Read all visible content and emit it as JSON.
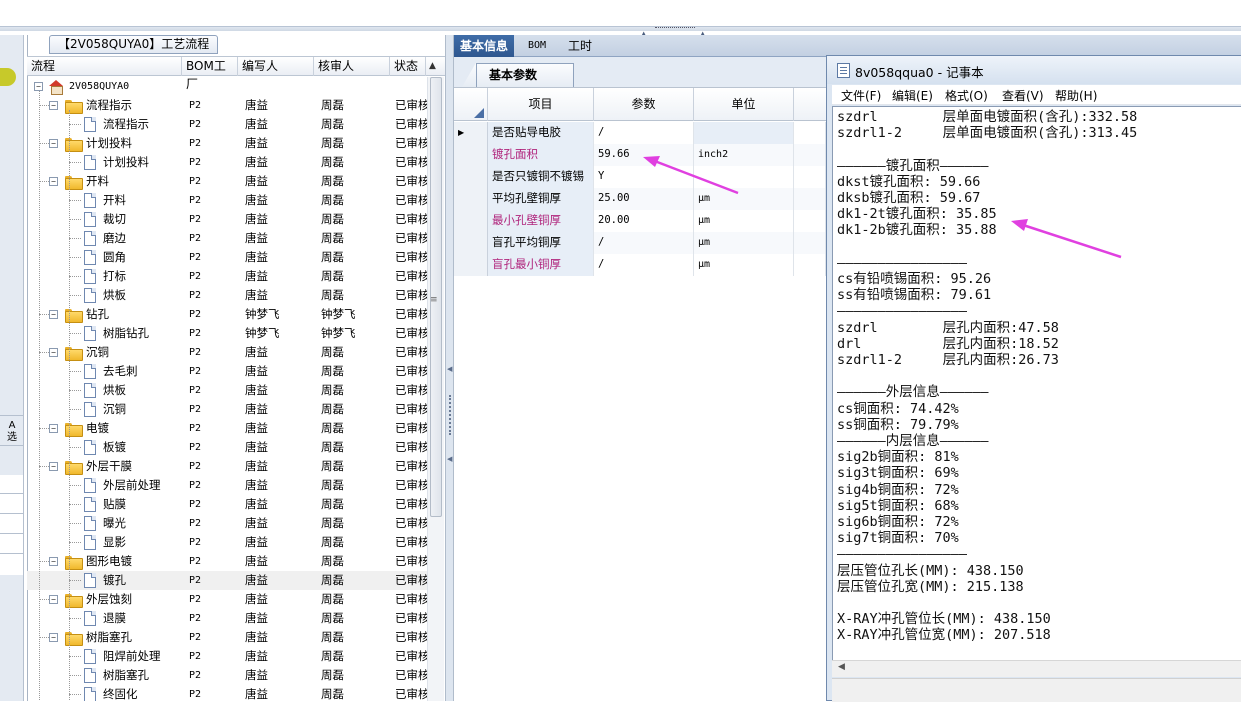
{
  "tree_panel": {
    "title": "【2V058QUYA0】工艺流程",
    "columns": [
      "流程",
      "BOM工厂",
      "编写人",
      "核审人",
      "状态"
    ],
    "rows": [
      {
        "level": 0,
        "type": "root",
        "label": "2V058QUYA0",
        "bom": "",
        "writer": "",
        "reviewer": "",
        "status": ""
      },
      {
        "level": 1,
        "type": "folder",
        "label": "流程指示",
        "bom": "P2",
        "writer": "唐益",
        "reviewer": "周磊",
        "status": "已审核"
      },
      {
        "level": 2,
        "type": "doc",
        "label": "流程指示",
        "bom": "P2",
        "writer": "唐益",
        "reviewer": "周磊",
        "status": "已审核"
      },
      {
        "level": 1,
        "type": "folder",
        "label": "计划投料",
        "bom": "P2",
        "writer": "唐益",
        "reviewer": "周磊",
        "status": "已审核"
      },
      {
        "level": 2,
        "type": "doc",
        "label": "计划投料",
        "bom": "P2",
        "writer": "唐益",
        "reviewer": "周磊",
        "status": "已审核"
      },
      {
        "level": 1,
        "type": "folder",
        "label": "开料",
        "bom": "P2",
        "writer": "唐益",
        "reviewer": "周磊",
        "status": "已审核"
      },
      {
        "level": 2,
        "type": "doc",
        "label": "开料",
        "bom": "P2",
        "writer": "唐益",
        "reviewer": "周磊",
        "status": "已审核"
      },
      {
        "level": 2,
        "type": "doc",
        "label": "裁切",
        "bom": "P2",
        "writer": "唐益",
        "reviewer": "周磊",
        "status": "已审核"
      },
      {
        "level": 2,
        "type": "doc",
        "label": "磨边",
        "bom": "P2",
        "writer": "唐益",
        "reviewer": "周磊",
        "status": "已审核"
      },
      {
        "level": 2,
        "type": "doc",
        "label": "圆角",
        "bom": "P2",
        "writer": "唐益",
        "reviewer": "周磊",
        "status": "已审核"
      },
      {
        "level": 2,
        "type": "doc",
        "label": "打标",
        "bom": "P2",
        "writer": "唐益",
        "reviewer": "周磊",
        "status": "已审核"
      },
      {
        "level": 2,
        "type": "doc",
        "label": "烘板",
        "bom": "P2",
        "writer": "唐益",
        "reviewer": "周磊",
        "status": "已审核"
      },
      {
        "level": 1,
        "type": "folder",
        "label": "钻孔",
        "bom": "P2",
        "writer": "钟梦飞",
        "reviewer": "钟梦飞",
        "status": "已审核"
      },
      {
        "level": 2,
        "type": "doc",
        "label": "树脂钻孔",
        "bom": "P2",
        "writer": "钟梦飞",
        "reviewer": "钟梦飞",
        "status": "已审核"
      },
      {
        "level": 1,
        "type": "folder",
        "label": "沉铜",
        "bom": "P2",
        "writer": "唐益",
        "reviewer": "周磊",
        "status": "已审核"
      },
      {
        "level": 2,
        "type": "doc",
        "label": "去毛刺",
        "bom": "P2",
        "writer": "唐益",
        "reviewer": "周磊",
        "status": "已审核"
      },
      {
        "level": 2,
        "type": "doc",
        "label": "烘板",
        "bom": "P2",
        "writer": "唐益",
        "reviewer": "周磊",
        "status": "已审核"
      },
      {
        "level": 2,
        "type": "doc",
        "label": "沉铜",
        "bom": "P2",
        "writer": "唐益",
        "reviewer": "周磊",
        "status": "已审核"
      },
      {
        "level": 1,
        "type": "folder",
        "label": "电镀",
        "bom": "P2",
        "writer": "唐益",
        "reviewer": "周磊",
        "status": "已审核"
      },
      {
        "level": 2,
        "type": "doc",
        "label": "板镀",
        "bom": "P2",
        "writer": "唐益",
        "reviewer": "周磊",
        "status": "已审核"
      },
      {
        "level": 1,
        "type": "folder",
        "label": "外层干膜",
        "bom": "P2",
        "writer": "唐益",
        "reviewer": "周磊",
        "status": "已审核"
      },
      {
        "level": 2,
        "type": "doc",
        "label": "外层前处理",
        "bom": "P2",
        "writer": "唐益",
        "reviewer": "周磊",
        "status": "已审核"
      },
      {
        "level": 2,
        "type": "doc",
        "label": "贴膜",
        "bom": "P2",
        "writer": "唐益",
        "reviewer": "周磊",
        "status": "已审核"
      },
      {
        "level": 2,
        "type": "doc",
        "label": "曝光",
        "bom": "P2",
        "writer": "唐益",
        "reviewer": "周磊",
        "status": "已审核"
      },
      {
        "level": 2,
        "type": "doc",
        "label": "显影",
        "bom": "P2",
        "writer": "唐益",
        "reviewer": "周磊",
        "status": "已审核"
      },
      {
        "level": 1,
        "type": "folder",
        "label": "图形电镀",
        "bom": "P2",
        "writer": "唐益",
        "reviewer": "周磊",
        "status": "已审核"
      },
      {
        "level": 2,
        "type": "doc",
        "label": "镀孔",
        "bom": "P2",
        "writer": "唐益",
        "reviewer": "周磊",
        "status": "已审核",
        "selected": true
      },
      {
        "level": 1,
        "type": "folder",
        "label": "外层蚀刻",
        "bom": "P2",
        "writer": "唐益",
        "reviewer": "周磊",
        "status": "已审核"
      },
      {
        "level": 2,
        "type": "doc",
        "label": "退膜",
        "bom": "P2",
        "writer": "唐益",
        "reviewer": "周磊",
        "status": "已审核"
      },
      {
        "level": 1,
        "type": "folder",
        "label": "树脂塞孔",
        "bom": "P2",
        "writer": "唐益",
        "reviewer": "周磊",
        "status": "已审核"
      },
      {
        "level": 2,
        "type": "doc",
        "label": "阻焊前处理",
        "bom": "P2",
        "writer": "唐益",
        "reviewer": "周磊",
        "status": "已审核"
      },
      {
        "level": 2,
        "type": "doc",
        "label": "树脂塞孔",
        "bom": "P2",
        "writer": "唐益",
        "reviewer": "周磊",
        "status": "已审核"
      },
      {
        "level": 2,
        "type": "doc",
        "label": "终固化",
        "bom": "P2",
        "writer": "唐益",
        "reviewer": "周磊",
        "status": "已审核"
      }
    ]
  },
  "left_strip": {
    "label_a": "A",
    "label_b": "选"
  },
  "main": {
    "tabs": [
      {
        "label": "基本信息",
        "active": true
      },
      {
        "label": "BOM",
        "active": false
      },
      {
        "label": "工时",
        "active": false
      }
    ],
    "sub_tab": "基本参数",
    "grid_columns": [
      "项目",
      "参数",
      "单位"
    ],
    "grid_rows": [
      {
        "item": "是否贴导电胶",
        "param": "/",
        "unit": "",
        "highlight": false,
        "current": true
      },
      {
        "item": "镀孔面积",
        "param": "59.66",
        "unit": "inch2",
        "highlight": true,
        "current": false
      },
      {
        "item": "是否只镀铜不镀锡",
        "param": "Y",
        "unit": "",
        "highlight": false,
        "current": false
      },
      {
        "item": "平均孔壁铜厚",
        "param": "25.00",
        "unit": "μm",
        "highlight": false,
        "current": false
      },
      {
        "item": "最小孔壁铜厚",
        "param": "20.00",
        "unit": "μm",
        "highlight": true,
        "current": false
      },
      {
        "item": "盲孔平均铜厚",
        "param": "/",
        "unit": "μm",
        "highlight": false,
        "current": false
      },
      {
        "item": "盲孔最小铜厚",
        "param": "/",
        "unit": "μm",
        "highlight": true,
        "current": false
      }
    ]
  },
  "notepad": {
    "title": "8v058qqua0 - 记事本",
    "menu": [
      "文件(F)",
      "编辑(E)",
      "格式(O)",
      "查看(V)",
      "帮助(H)"
    ],
    "lines": [
      "szdrl        层单面电镀面积(含孔):332.58",
      "szdrl1-2     层单面电镀面积(含孔):313.45",
      "",
      "——————镀孔面积——————",
      "dkst镀孔面积: 59.66",
      "dksb镀孔面积: 59.67",
      "dk1-2t镀孔面积: 35.85",
      "dk1-2b镀孔面积: 35.88",
      "",
      "————————————————",
      "cs有铅喷锡面积: 95.26",
      "ss有铅喷锡面积: 79.61",
      "————————————————",
      "szdrl        层孔内面积:47.58",
      "drl          层孔内面积:18.52",
      "szdrl1-2     层孔内面积:26.73",
      "",
      "——————外层信息——————",
      "cs铜面积: 74.42%",
      "ss铜面积: 79.79%",
      "——————内层信息——————",
      "sig2b铜面积: 81%",
      "sig3t铜面积: 69%",
      "sig4b铜面积: 72%",
      "sig5t铜面积: 68%",
      "sig6b铜面积: 72%",
      "sig7t铜面积: 70%",
      "————————————————",
      "层压管位孔长(MM): 438.150",
      "层压管位孔宽(MM): 215.138",
      "",
      "X-RAY冲孔管位长(MM): 438.150",
      "X-RAY冲孔管位宽(MM): 207.518"
    ]
  },
  "colors": {
    "highlight_text": "#b0247c",
    "annotation_arrow": "#e040e0",
    "active_tab": "#2e578f"
  }
}
